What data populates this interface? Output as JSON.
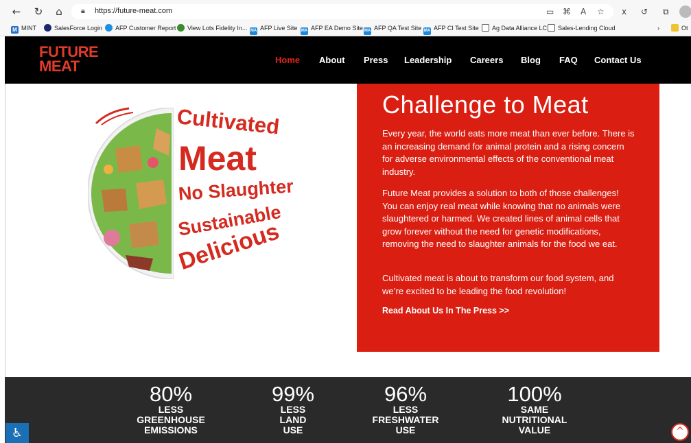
{
  "browser": {
    "url": "https://future-meat.com",
    "bookmarks": [
      {
        "label": "MINT",
        "icon": "m-icon"
      },
      {
        "label": "SalesForce Login",
        "icon": "salesforce-icon"
      },
      {
        "label": "AFP Customer Report",
        "icon": "cloud-icon"
      },
      {
        "label": "View Lots Fidelity In...",
        "icon": "fidelity-icon"
      },
      {
        "label": "AFP Live Site",
        "icon": "ma-icon"
      },
      {
        "label": "AFP EA Demo Site",
        "icon": "ma-icon"
      },
      {
        "label": "AFP QA Test Site",
        "icon": "ma-icon"
      },
      {
        "label": "AFP CI Test Site",
        "icon": "ma-icon"
      },
      {
        "label": "Ag Data Alliance LC",
        "icon": "page-icon"
      },
      {
        "label": "Sales-Lending Cloud",
        "icon": "page-icon"
      },
      {
        "label": "Ot",
        "icon": "folder-icon"
      }
    ]
  },
  "site": {
    "logo_line1": "FUTURE",
    "logo_line2": "MEAT",
    "nav": [
      "Home",
      "About",
      "Press",
      "Leadership",
      "Careers",
      "Blog",
      "FAQ",
      "Contact Us"
    ],
    "active_nav": "Home"
  },
  "hero": {
    "image_words": [
      "Cultivated",
      "Meat",
      "No Slaughter",
      "Sustainable",
      "Delicious"
    ],
    "title": "Challenge to Meat",
    "paragraphs": [
      "Every year, the world eats more meat than ever before. There is an increasing demand for animal protein and a rising concern for adverse environmental effects of the conventional meat industry.",
      "Future Meat provides a solution to both of those challenges! You can enjoy real meat while knowing that no animals were slaughtered or harmed. We created lines of animal cells that grow forever without the need for genetic modifications, removing the need to slaughter animals for the food we eat.",
      "Cultivated meat is about to transform our food system, and we’re excited to be leading the food revolution!"
    ],
    "link": "Read About Us In The Press >>"
  },
  "stats": [
    {
      "value": "80%",
      "label": [
        "LESS",
        "GREENHOUSE",
        "EMISSIONS"
      ]
    },
    {
      "value": "99%",
      "label": [
        "LESS",
        "LAND",
        "USE"
      ]
    },
    {
      "value": "96%",
      "label": [
        "LESS",
        "FRESHWATER",
        "USE"
      ]
    },
    {
      "value": "100%",
      "label": [
        "SAME",
        "NUTRITIONAL",
        "VALUE"
      ]
    }
  ],
  "colors": {
    "brand_red": "#da1f12",
    "header_bg": "#000000",
    "stats_bg": "#2a2a2a"
  }
}
